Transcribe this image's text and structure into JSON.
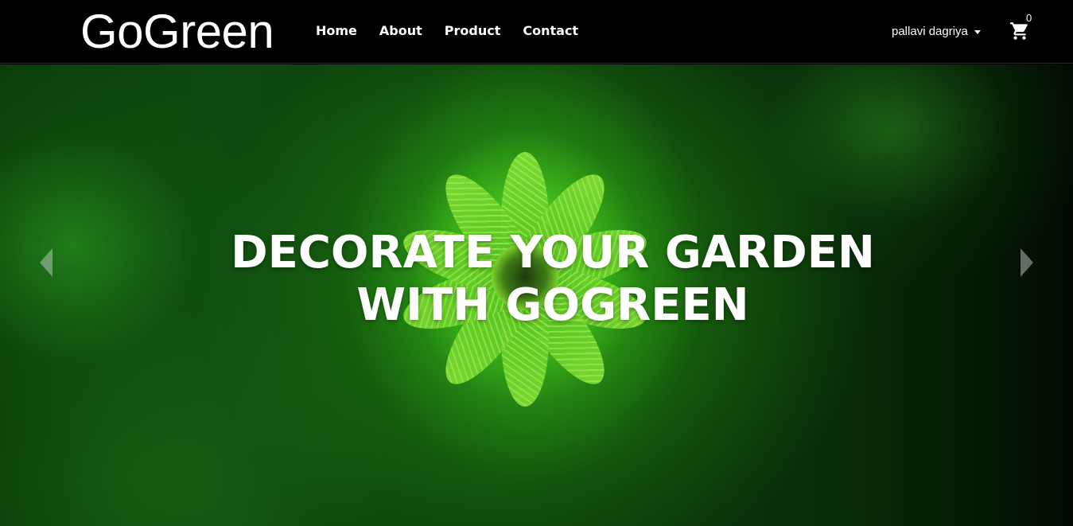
{
  "navbar": {
    "brand": "GoGreen",
    "links": [
      "Home",
      "About",
      "Product",
      "Contact"
    ],
    "user_name": "pallavi dagriya",
    "cart_icon": "cart-icon",
    "cart_count": "0"
  },
  "hero": {
    "title_line1": "DECORATE YOUR GARDEN",
    "title_line2": "WITH GOGREEN",
    "prev_icon": "chevron-left-icon",
    "next_icon": "chevron-right-icon"
  },
  "colors": {
    "navbar_bg": "#000000",
    "text": "#ffffff",
    "hero_green": "#3da614"
  }
}
